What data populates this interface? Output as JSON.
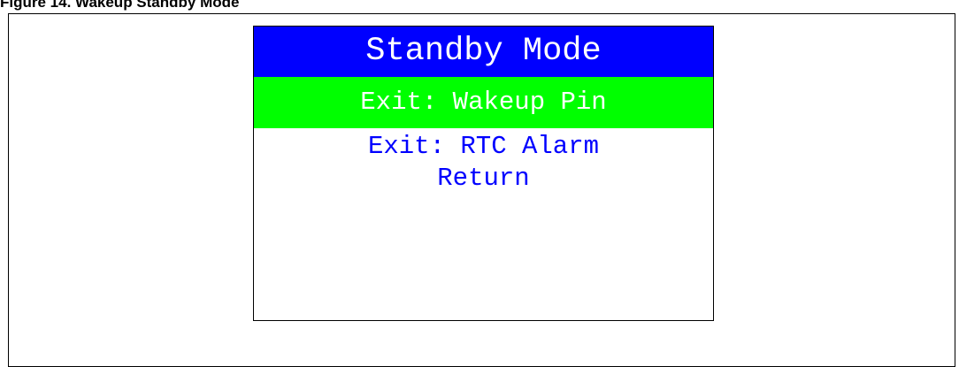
{
  "caption": "Figure 14. Wakeup Standby Mode",
  "lcd": {
    "title": "Standby Mode",
    "menu_items": [
      "Exit: Wakeup Pin",
      "Exit: RTC Alarm",
      "Return"
    ],
    "selected_index": 0
  },
  "colors": {
    "title_bg": "#0000ff",
    "title_text": "#ffffff",
    "selected_bg": "#00ff00",
    "selected_text": "#ffffff",
    "item_text": "#0000ff"
  }
}
